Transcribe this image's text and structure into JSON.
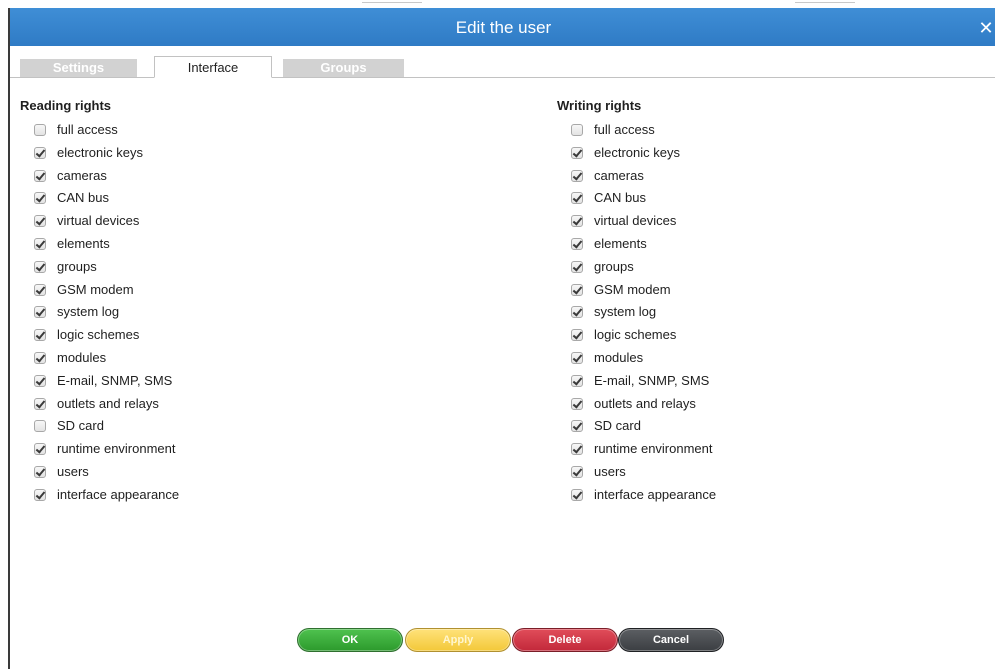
{
  "dialog": {
    "title": "Edit the user",
    "close_glyph": "✕"
  },
  "tabs": [
    {
      "label": "Settings",
      "active": false
    },
    {
      "label": "Interface",
      "active": true
    },
    {
      "label": "Groups",
      "active": false
    }
  ],
  "reading": {
    "title": "Reading rights",
    "items": [
      {
        "label": "full access",
        "checked": false
      },
      {
        "label": "electronic keys",
        "checked": true
      },
      {
        "label": "cameras",
        "checked": true
      },
      {
        "label": "CAN bus",
        "checked": true
      },
      {
        "label": "virtual devices",
        "checked": true
      },
      {
        "label": "elements",
        "checked": true
      },
      {
        "label": "groups",
        "checked": true
      },
      {
        "label": "GSM modem",
        "checked": true
      },
      {
        "label": "system log",
        "checked": true
      },
      {
        "label": "logic schemes",
        "checked": true
      },
      {
        "label": "modules",
        "checked": true
      },
      {
        "label": "E-mail, SNMP, SMS",
        "checked": true
      },
      {
        "label": "outlets and relays",
        "checked": true
      },
      {
        "label": "SD card",
        "checked": false
      },
      {
        "label": "runtime environment",
        "checked": true
      },
      {
        "label": "users",
        "checked": true
      },
      {
        "label": "interface appearance",
        "checked": true
      }
    ]
  },
  "writing": {
    "title": "Writing rights",
    "items": [
      {
        "label": "full access",
        "checked": false
      },
      {
        "label": "electronic keys",
        "checked": true
      },
      {
        "label": "cameras",
        "checked": true
      },
      {
        "label": "CAN bus",
        "checked": true
      },
      {
        "label": "virtual devices",
        "checked": true
      },
      {
        "label": "elements",
        "checked": true
      },
      {
        "label": "groups",
        "checked": true
      },
      {
        "label": "GSM modem",
        "checked": true
      },
      {
        "label": "system log",
        "checked": true
      },
      {
        "label": "logic schemes",
        "checked": true
      },
      {
        "label": "modules",
        "checked": true
      },
      {
        "label": "E-mail, SNMP, SMS",
        "checked": true
      },
      {
        "label": "outlets and relays",
        "checked": true
      },
      {
        "label": "SD card",
        "checked": true
      },
      {
        "label": "runtime environment",
        "checked": true
      },
      {
        "label": "users",
        "checked": true
      },
      {
        "label": "interface appearance",
        "checked": true
      }
    ]
  },
  "buttons": {
    "ok": "OK",
    "apply": "Apply",
    "delete": "Delete",
    "cancel": "Cancel"
  },
  "colors": {
    "titlebar": "#3386d0",
    "ok": "#3cae3c",
    "apply": "#f7d45a",
    "delete": "#d23a4a",
    "cancel": "#4a4d51"
  }
}
